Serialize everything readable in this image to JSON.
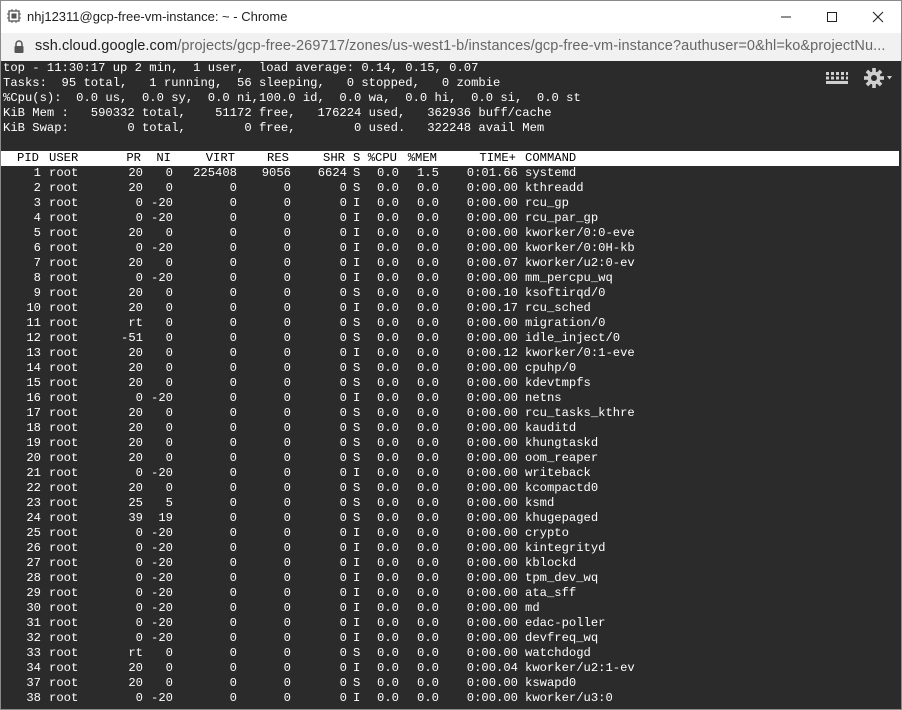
{
  "window": {
    "title": "nhj12311@gcp-free-vm-instance: ~ - Chrome",
    "url_host": "ssh.cloud.google.com",
    "url_path": "/projects/gcp-free-269717/zones/us-west1-b/instances/gcp-free-vm-instance?authuser=0&hl=ko&projectNu..."
  },
  "top_summary": [
    "top - 11:30:17 up 2 min,  1 user,  load average: 0.14, 0.15, 0.07",
    "Tasks:  95 total,   1 running,  56 sleeping,   0 stopped,   0 zombie",
    "%Cpu(s):  0.0 us,  0.0 sy,  0.0 ni,100.0 id,  0.0 wa,  0.0 hi,  0.0 si,  0.0 st",
    "KiB Mem :   590332 total,    51172 free,   176224 used,   362936 buff/cache",
    "KiB Swap:        0 total,        0 free,        0 used.   322248 avail Mem"
  ],
  "columns": [
    "PID",
    "USER",
    "PR",
    "NI",
    "VIRT",
    "RES",
    "SHR",
    "S",
    "%CPU",
    "%MEM",
    "TIME+",
    "COMMAND"
  ],
  "processes": [
    [
      "1",
      "root",
      "20",
      "0",
      "225408",
      "9056",
      "6624",
      "S",
      "0.0",
      "1.5",
      "0:01.66",
      "systemd"
    ],
    [
      "2",
      "root",
      "20",
      "0",
      "0",
      "0",
      "0",
      "S",
      "0.0",
      "0.0",
      "0:00.00",
      "kthreadd"
    ],
    [
      "3",
      "root",
      "0",
      "-20",
      "0",
      "0",
      "0",
      "I",
      "0.0",
      "0.0",
      "0:00.00",
      "rcu_gp"
    ],
    [
      "4",
      "root",
      "0",
      "-20",
      "0",
      "0",
      "0",
      "I",
      "0.0",
      "0.0",
      "0:00.00",
      "rcu_par_gp"
    ],
    [
      "5",
      "root",
      "20",
      "0",
      "0",
      "0",
      "0",
      "I",
      "0.0",
      "0.0",
      "0:00.00",
      "kworker/0:0-eve"
    ],
    [
      "6",
      "root",
      "0",
      "-20",
      "0",
      "0",
      "0",
      "I",
      "0.0",
      "0.0",
      "0:00.00",
      "kworker/0:0H-kb"
    ],
    [
      "7",
      "root",
      "20",
      "0",
      "0",
      "0",
      "0",
      "I",
      "0.0",
      "0.0",
      "0:00.07",
      "kworker/u2:0-ev"
    ],
    [
      "8",
      "root",
      "0",
      "-20",
      "0",
      "0",
      "0",
      "I",
      "0.0",
      "0.0",
      "0:00.00",
      "mm_percpu_wq"
    ],
    [
      "9",
      "root",
      "20",
      "0",
      "0",
      "0",
      "0",
      "S",
      "0.0",
      "0.0",
      "0:00.10",
      "ksoftirqd/0"
    ],
    [
      "10",
      "root",
      "20",
      "0",
      "0",
      "0",
      "0",
      "I",
      "0.0",
      "0.0",
      "0:00.17",
      "rcu_sched"
    ],
    [
      "11",
      "root",
      "rt",
      "0",
      "0",
      "0",
      "0",
      "S",
      "0.0",
      "0.0",
      "0:00.00",
      "migration/0"
    ],
    [
      "12",
      "root",
      "-51",
      "0",
      "0",
      "0",
      "0",
      "S",
      "0.0",
      "0.0",
      "0:00.00",
      "idle_inject/0"
    ],
    [
      "13",
      "root",
      "20",
      "0",
      "0",
      "0",
      "0",
      "I",
      "0.0",
      "0.0",
      "0:00.12",
      "kworker/0:1-eve"
    ],
    [
      "14",
      "root",
      "20",
      "0",
      "0",
      "0",
      "0",
      "S",
      "0.0",
      "0.0",
      "0:00.00",
      "cpuhp/0"
    ],
    [
      "15",
      "root",
      "20",
      "0",
      "0",
      "0",
      "0",
      "S",
      "0.0",
      "0.0",
      "0:00.00",
      "kdevtmpfs"
    ],
    [
      "16",
      "root",
      "0",
      "-20",
      "0",
      "0",
      "0",
      "I",
      "0.0",
      "0.0",
      "0:00.00",
      "netns"
    ],
    [
      "17",
      "root",
      "20",
      "0",
      "0",
      "0",
      "0",
      "S",
      "0.0",
      "0.0",
      "0:00.00",
      "rcu_tasks_kthre"
    ],
    [
      "18",
      "root",
      "20",
      "0",
      "0",
      "0",
      "0",
      "S",
      "0.0",
      "0.0",
      "0:00.00",
      "kauditd"
    ],
    [
      "19",
      "root",
      "20",
      "0",
      "0",
      "0",
      "0",
      "S",
      "0.0",
      "0.0",
      "0:00.00",
      "khungtaskd"
    ],
    [
      "20",
      "root",
      "20",
      "0",
      "0",
      "0",
      "0",
      "S",
      "0.0",
      "0.0",
      "0:00.00",
      "oom_reaper"
    ],
    [
      "21",
      "root",
      "0",
      "-20",
      "0",
      "0",
      "0",
      "I",
      "0.0",
      "0.0",
      "0:00.00",
      "writeback"
    ],
    [
      "22",
      "root",
      "20",
      "0",
      "0",
      "0",
      "0",
      "S",
      "0.0",
      "0.0",
      "0:00.00",
      "kcompactd0"
    ],
    [
      "23",
      "root",
      "25",
      "5",
      "0",
      "0",
      "0",
      "S",
      "0.0",
      "0.0",
      "0:00.00",
      "ksmd"
    ],
    [
      "24",
      "root",
      "39",
      "19",
      "0",
      "0",
      "0",
      "S",
      "0.0",
      "0.0",
      "0:00.00",
      "khugepaged"
    ],
    [
      "25",
      "root",
      "0",
      "-20",
      "0",
      "0",
      "0",
      "I",
      "0.0",
      "0.0",
      "0:00.00",
      "crypto"
    ],
    [
      "26",
      "root",
      "0",
      "-20",
      "0",
      "0",
      "0",
      "I",
      "0.0",
      "0.0",
      "0:00.00",
      "kintegrityd"
    ],
    [
      "27",
      "root",
      "0",
      "-20",
      "0",
      "0",
      "0",
      "I",
      "0.0",
      "0.0",
      "0:00.00",
      "kblockd"
    ],
    [
      "28",
      "root",
      "0",
      "-20",
      "0",
      "0",
      "0",
      "I",
      "0.0",
      "0.0",
      "0:00.00",
      "tpm_dev_wq"
    ],
    [
      "29",
      "root",
      "0",
      "-20",
      "0",
      "0",
      "0",
      "I",
      "0.0",
      "0.0",
      "0:00.00",
      "ata_sff"
    ],
    [
      "30",
      "root",
      "0",
      "-20",
      "0",
      "0",
      "0",
      "I",
      "0.0",
      "0.0",
      "0:00.00",
      "md"
    ],
    [
      "31",
      "root",
      "0",
      "-20",
      "0",
      "0",
      "0",
      "I",
      "0.0",
      "0.0",
      "0:00.00",
      "edac-poller"
    ],
    [
      "32",
      "root",
      "0",
      "-20",
      "0",
      "0",
      "0",
      "I",
      "0.0",
      "0.0",
      "0:00.00",
      "devfreq_wq"
    ],
    [
      "33",
      "root",
      "rt",
      "0",
      "0",
      "0",
      "0",
      "S",
      "0.0",
      "0.0",
      "0:00.00",
      "watchdogd"
    ],
    [
      "34",
      "root",
      "20",
      "0",
      "0",
      "0",
      "0",
      "I",
      "0.0",
      "0.0",
      "0:00.04",
      "kworker/u2:1-ev"
    ],
    [
      "37",
      "root",
      "20",
      "0",
      "0",
      "0",
      "0",
      "S",
      "0.0",
      "0.0",
      "0:00.00",
      "kswapd0"
    ],
    [
      "38",
      "root",
      "0",
      "-20",
      "0",
      "0",
      "0",
      "I",
      "0.0",
      "0.0",
      "0:00.00",
      "kworker/u3:0"
    ]
  ],
  "icons": {
    "app": "chrome-app-icon",
    "minimize": "minimize-icon",
    "maximize": "maximize-icon",
    "close": "close-icon",
    "lock": "lock-icon",
    "keyboard": "keyboard-icon",
    "settings": "gear-icon"
  },
  "colors": {
    "terminal_bg": "#2b2b2b",
    "terminal_fg": "#ffffff",
    "header_bg": "#ffffff",
    "header_fg": "#000000"
  }
}
